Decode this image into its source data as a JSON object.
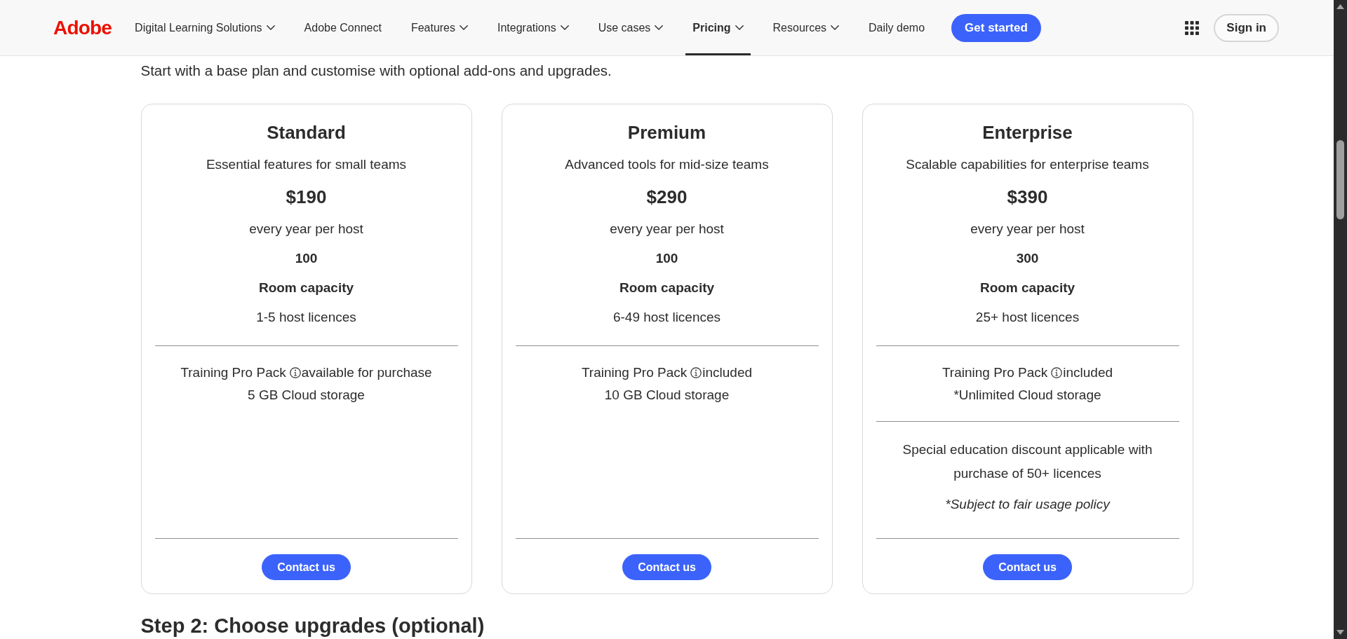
{
  "nav": {
    "logo": "Adobe",
    "items": [
      {
        "label": "Digital Learning Solutions",
        "dropdown": true,
        "selected": false
      },
      {
        "label": "Adobe Connect",
        "dropdown": false,
        "selected": false
      },
      {
        "label": "Features",
        "dropdown": true,
        "selected": false
      },
      {
        "label": "Integrations",
        "dropdown": true,
        "selected": false
      },
      {
        "label": "Use cases",
        "dropdown": true,
        "selected": false
      },
      {
        "label": "Pricing",
        "dropdown": true,
        "selected": true
      },
      {
        "label": "Resources",
        "dropdown": true,
        "selected": false
      },
      {
        "label": "Daily demo",
        "dropdown": false,
        "selected": false
      }
    ],
    "cta": "Get started",
    "sign_in": "Sign in"
  },
  "intro": "Start with a base plan and customise with optional add-ons and upgrades.",
  "plans": [
    {
      "name": "Standard",
      "tagline": "Essential features for small teams",
      "price": "$190",
      "period": "every year per host",
      "capacity": "100",
      "capacity_label": "Room capacity",
      "licences": "1-5 host licences",
      "features": [
        {
          "kind": "addon",
          "label": "Training Pro Pack",
          "info": true,
          "status": "available for purchase"
        },
        {
          "kind": "text",
          "text": "5 GB Cloud storage"
        }
      ],
      "button": "Contact us"
    },
    {
      "name": "Premium",
      "tagline": "Advanced tools for mid-size teams",
      "price": "$290",
      "period": "every year per host",
      "capacity": "100",
      "capacity_label": "Room capacity",
      "licences": "6-49 host licences",
      "features": [
        {
          "kind": "addon",
          "label": "Training Pro Pack",
          "info": true,
          "status": "included"
        },
        {
          "kind": "text",
          "text": "10 GB Cloud storage"
        }
      ],
      "button": "Contact us"
    },
    {
      "name": "Enterprise",
      "tagline": "Scalable capabilities for enterprise teams",
      "price": "$390",
      "period": "every year per host",
      "capacity": "300",
      "capacity_label": "Room capacity",
      "licences": "25+ host licences",
      "features": [
        {
          "kind": "addon",
          "label": "Training Pro Pack",
          "info": true,
          "status": "included"
        },
        {
          "kind": "text",
          "text": "*Unlimited Cloud storage"
        }
      ],
      "notes": [
        {
          "kind": "text",
          "text": "Special education discount applicable with purchase of 50+ licences"
        },
        {
          "kind": "footnote",
          "text": "*Subject to fair usage policy"
        }
      ],
      "button": "Contact us"
    }
  ],
  "next_heading": "Step 2: Choose upgrades (optional)"
}
